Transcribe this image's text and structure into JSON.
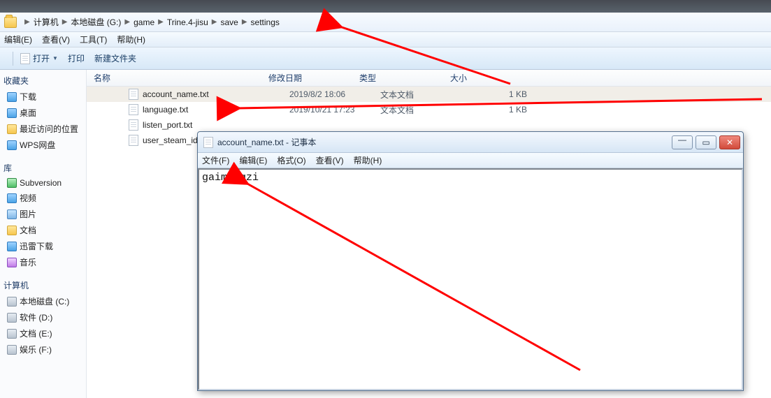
{
  "breadcrumb": {
    "items": [
      "计算机",
      "本地磁盘 (G:)",
      "game",
      "Trine.4-jisu",
      "save",
      "settings"
    ]
  },
  "menubar": {
    "edit": "编辑(E)",
    "view": "查看(V)",
    "tools": "工具(T)",
    "help": "帮助(H)"
  },
  "toolbar": {
    "open_label": "打开",
    "print_label": "打印",
    "new_folder_label": "新建文件夹"
  },
  "columns": {
    "name": "名称",
    "date": "修改日期",
    "type": "类型",
    "size": "大小"
  },
  "files": [
    {
      "name": "account_name.txt",
      "date": "2019/8/2 18:06",
      "type": "文本文档",
      "size": "1 KB",
      "selected": true
    },
    {
      "name": "language.txt",
      "date": "2019/10/21 17:23",
      "type": "文本文档",
      "size": "1 KB",
      "selected": false
    },
    {
      "name": "listen_port.txt",
      "date": "",
      "type": "",
      "size": "",
      "selected": false
    },
    {
      "name": "user_steam_id.txt",
      "date": "",
      "type": "",
      "size": "",
      "selected": false
    }
  ],
  "sidebar": {
    "fav_header": "收藏夹",
    "favorites": [
      "下载",
      "桌面",
      "最近访问的位置",
      "WPS网盘"
    ],
    "lib_header": "库",
    "libraries": [
      "Subversion",
      "视频",
      "图片",
      "文档",
      "迅雷下载",
      "音乐"
    ],
    "comp_header": "计算机",
    "drives": [
      "本地磁盘 (C:)",
      "软件 (D:)",
      "文档 (E:)",
      "娱乐 (F:)"
    ]
  },
  "notepad": {
    "title": "account_name.txt - 记事本",
    "menu": {
      "file": "文件(F)",
      "edit": "编辑(E)",
      "format": "格式(O)",
      "view": "查看(V)",
      "help": "帮助(H)"
    },
    "content": "gaimingzi"
  }
}
